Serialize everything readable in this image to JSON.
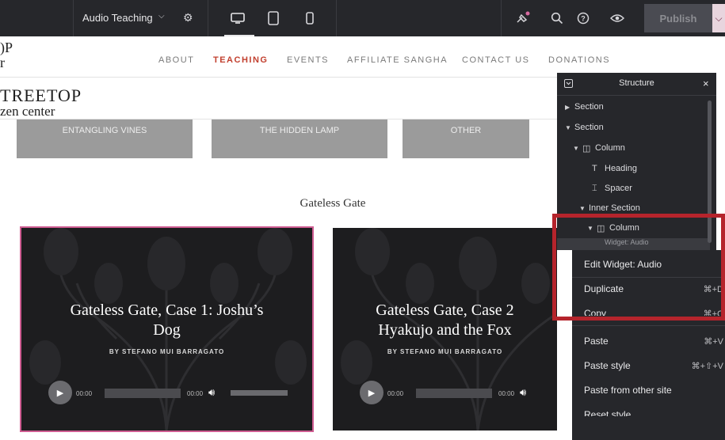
{
  "topbar": {
    "page_title": "Audio Teaching",
    "publish_label": "Publish"
  },
  "site": {
    "logo_small": [
      ")P",
      "r"
    ],
    "logo_big": [
      "TREETOP",
      "zen center"
    ],
    "nav": [
      "ABOUT",
      "TEACHING",
      "EVENTS",
      "AFFILIATE SANGHA",
      "CONTACT US",
      "DONATIONS"
    ],
    "category_buttons": [
      "ENTANGLING VINES",
      "THE HIDDEN LAMP",
      "OTHER"
    ],
    "section_heading": "Gateless Gate",
    "cards": [
      {
        "title_lines": [
          "Gateless Gate, Case 1: Joshu’s",
          "Dog"
        ],
        "byline": "BY STEFANO MUI BARRAGATO",
        "time_start": "00:00",
        "time_end": "00:00"
      },
      {
        "title_lines": [
          "Gateless Gate, Case 2",
          "Hyakujo and the Fox"
        ],
        "byline": "BY STEFANO MUI BARRAGATO",
        "time_start": "00:00",
        "time_end": "00:00"
      }
    ]
  },
  "structure_panel": {
    "title": "Structure",
    "close": "×",
    "rows": [
      {
        "label": "Section"
      },
      {
        "label": "Section"
      },
      {
        "label": "Column"
      },
      {
        "label": "Heading"
      },
      {
        "label": "Spacer"
      },
      {
        "label": "Inner Section"
      },
      {
        "label": "Column"
      },
      {
        "label": "Widget: Audio"
      }
    ]
  },
  "context_menu": {
    "items": [
      {
        "label": "Edit Widget: Audio",
        "shortcut": ""
      },
      {
        "label": "Duplicate",
        "shortcut": "⌘+D"
      },
      {
        "label": "Copy",
        "shortcut": "⌘+C"
      },
      {
        "label": "Paste",
        "shortcut": "⌘+V"
      },
      {
        "label": "Paste style",
        "shortcut": "⌘+⇧+V"
      },
      {
        "label": "Paste from other site",
        "shortcut": ""
      },
      {
        "label": "Reset style",
        "shortcut": ""
      }
    ]
  },
  "colors": {
    "editor_dark": "#26272b",
    "nav_active": "#c2402f",
    "highlight": "#b5242c",
    "selection_outline": "#cf5d92"
  }
}
